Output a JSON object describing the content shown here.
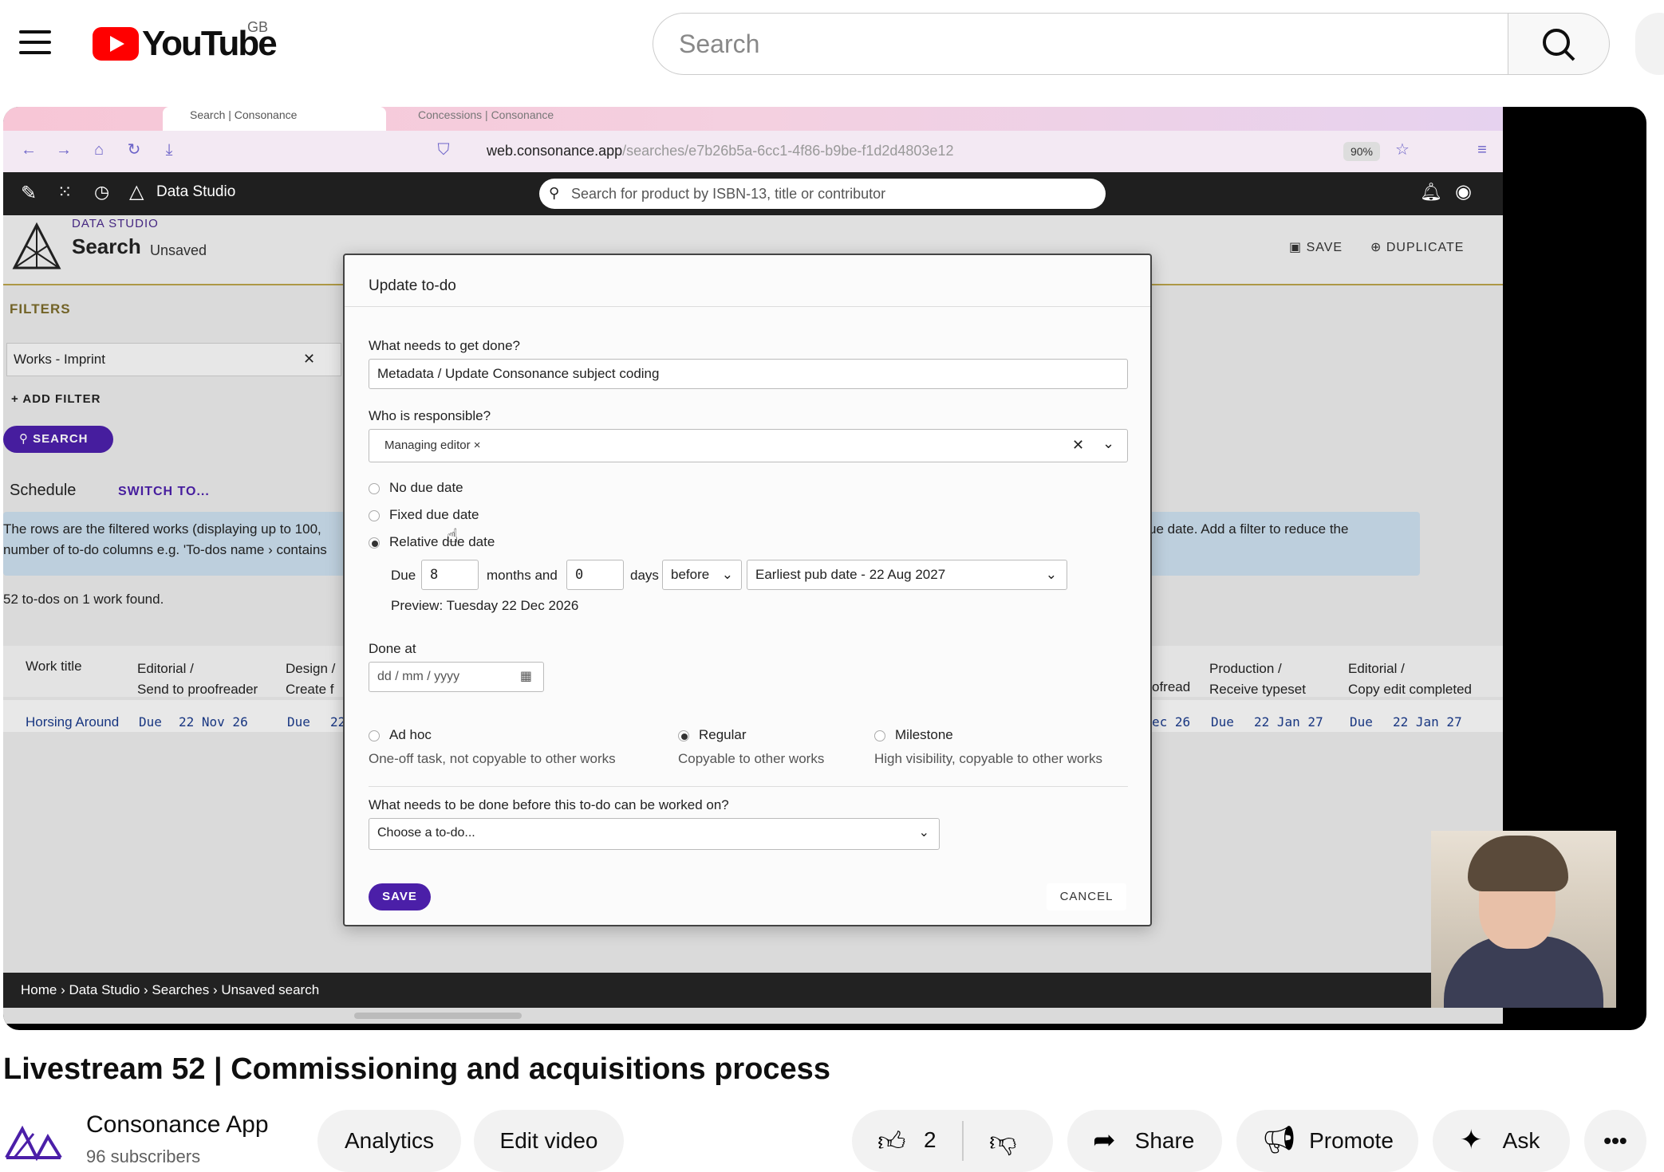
{
  "youtube": {
    "logo_text": "YouTube",
    "region": "GB",
    "search_placeholder": "Search"
  },
  "browser": {
    "tabs": [
      {
        "label": "Search | Consonance"
      },
      {
        "label": "Concessions | Consonance"
      }
    ],
    "url_domain": "web.consonance.app",
    "url_path": "/searches/e7b26b5a-6cc1-4f86-b9be-f1d2d4803e12",
    "zoom": "90%"
  },
  "app": {
    "section": "Data Studio",
    "search_placeholder": "Search for product by ISBN-13, title or contributor",
    "breadcrumb_top": "DATA STUDIO",
    "page_title": "Search",
    "page_status": "Unsaved",
    "save_label": "SAVE",
    "duplicate_label": "DUPLICATE",
    "filters_label": "FILTERS",
    "filter_value": "Works - Imprint",
    "add_filter": "ADD FILTER",
    "search_btn": "SEARCH",
    "schedule_label": "Schedule",
    "switch_to": "SWITCH TO...",
    "info_line1": "The rows are the filtered works (displaying up to 100,",
    "info_line2": "number of to-do columns e.g. 'To-dos name › contains",
    "info_right": "ue date. Add a filter to reduce the",
    "count_text": "52 to-dos on 1 work found.",
    "columns": [
      {
        "l1": "Work title",
        "l2": ""
      },
      {
        "l1": "Editorial /",
        "l2": "Send to proofreader"
      },
      {
        "l1": "Design /",
        "l2": "Create f"
      },
      {
        "l1": "",
        "l2": "ofread"
      },
      {
        "l1": "Production /",
        "l2": "Receive typeset"
      },
      {
        "l1": "Editorial /",
        "l2": "Copy edit completed"
      }
    ],
    "row": {
      "title": "Horsing Around",
      "c1_due": "Due",
      "c1_date": "22 Nov 26",
      "c2_due": "Due",
      "c2_date": "22",
      "c3_date": "ec 26",
      "c4_due": "Due",
      "c4_date": "22 Jan 27",
      "c5_due": "Due",
      "c5_date": "22 Jan 27"
    },
    "footer_breadcrumb": "Home › Data Studio › Searches › Unsaved search"
  },
  "modal": {
    "title": "Update to-do",
    "q_what": "What needs to get done?",
    "what_value": "Metadata / Update Consonance subject coding",
    "q_who": "Who is responsible?",
    "who_chip": "Managing editor",
    "opt_no_due": "No due date",
    "opt_fixed_due": "Fixed due date",
    "opt_relative_due": "Relative due date",
    "due_label": "Due",
    "months_value": "8",
    "months_and": "months and",
    "days_value": "0",
    "days_label": "days",
    "before_value": "before",
    "anchor_value": "Earliest pub date - 22 Aug 2027",
    "preview": "Preview: Tuesday 22 Dec 2026",
    "done_at_label": "Done at",
    "done_at_placeholder": "dd / mm / yyyy",
    "type_adhoc": "Ad hoc",
    "type_adhoc_desc": "One-off task, not copyable to other works",
    "type_regular": "Regular",
    "type_regular_desc": "Copyable to other works",
    "type_milestone": "Milestone",
    "type_milestone_desc": "High visibility, copyable to other works",
    "q_before": "What needs to be done before this to-do can be worked on?",
    "before_placeholder": "Choose a to-do...",
    "save": "SAVE",
    "cancel": "CANCEL"
  },
  "video": {
    "title": "Livestream 52 | Commissioning and acquisitions process",
    "channel_name": "Consonance App",
    "subscribers": "96 subscribers",
    "analytics": "Analytics",
    "edit_video": "Edit video",
    "likes": "2",
    "share": "Share",
    "promote": "Promote",
    "ask": "Ask"
  },
  "colors": {
    "accent": "#4b1fa8",
    "youtube_red": "#ff0000",
    "info_bg": "#c9dceb"
  }
}
